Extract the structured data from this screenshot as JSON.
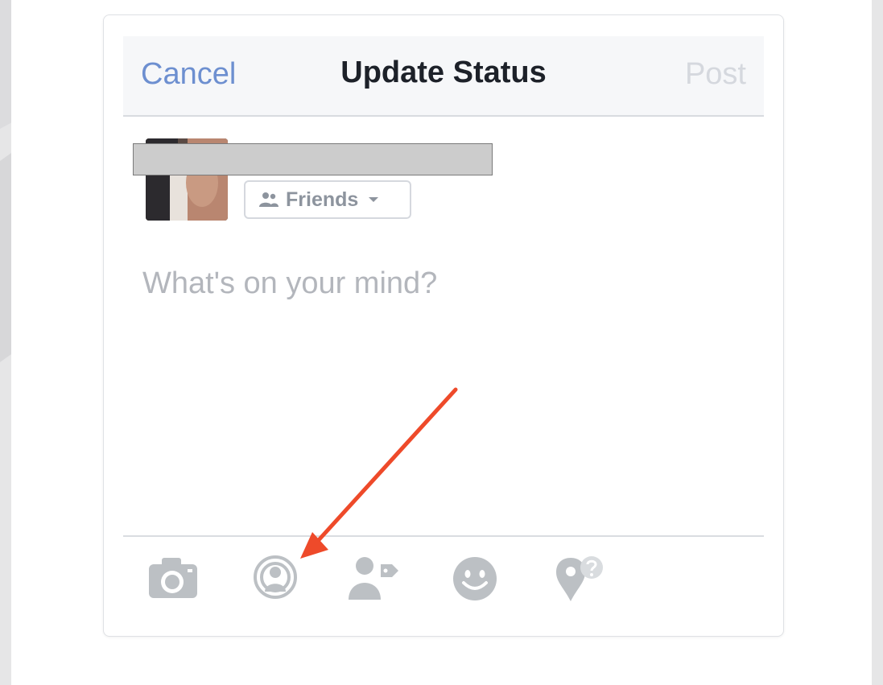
{
  "nav": {
    "cancel_label": "Cancel",
    "title": "Update Status",
    "post_label": "Post"
  },
  "audience": {
    "label": "Friends"
  },
  "composer": {
    "placeholder": "What's on your mind?"
  },
  "toolbar": {
    "icons": [
      "camera-icon",
      "live-video-icon",
      "tag-friends-icon",
      "feeling-icon",
      "check-in-icon"
    ]
  },
  "colors": {
    "link_blue": "#6d8fd0",
    "title_text": "#1d2129",
    "disabled_text": "#d5d8de",
    "icon_gray": "#bcc0c4",
    "annotation_arrow": "#ee4a2a"
  }
}
